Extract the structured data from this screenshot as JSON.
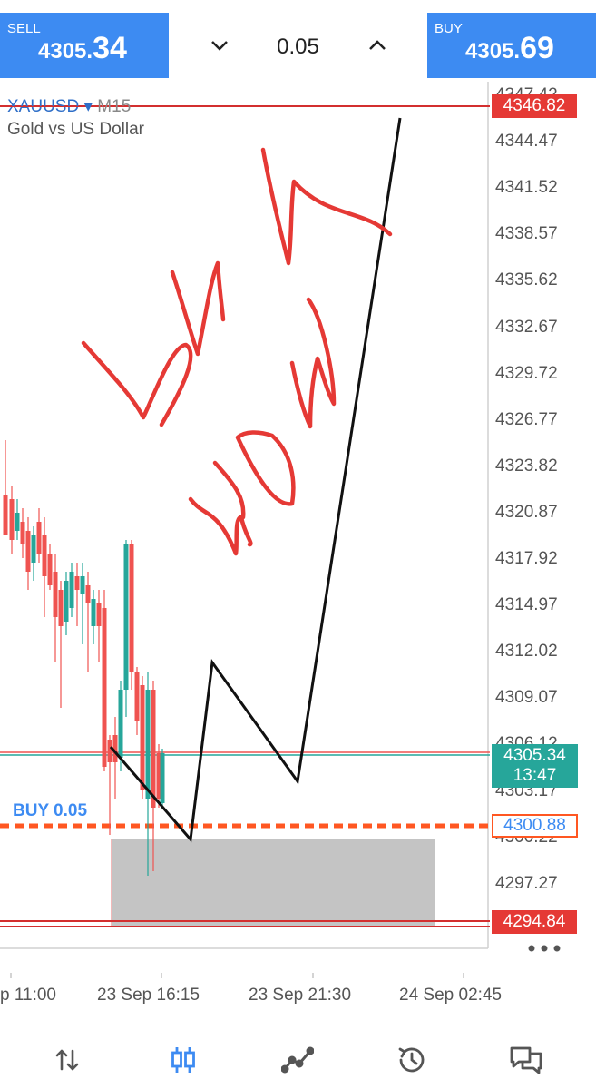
{
  "trade_bar": {
    "sell": {
      "label": "SELL",
      "price_prefix": "4305.",
      "price_suffix": "34"
    },
    "buy": {
      "label": "BUY",
      "price_prefix": "4305.",
      "price_suffix": "69"
    },
    "lot": {
      "value": "0.05",
      "decrease_icon": "chevron-down-icon",
      "increase_icon": "chevron-up-icon"
    }
  },
  "chart": {
    "symbol": "XAUUSD",
    "timeframe": "M15",
    "description": "Gold vs US Dollar",
    "price_ticks": [
      "4347.42",
      "4344.47",
      "4341.52",
      "4338.57",
      "4335.62",
      "4332.67",
      "4329.72",
      "4326.77",
      "4323.82",
      "4320.87",
      "4317.92",
      "4314.97",
      "4312.02",
      "4309.07",
      "4306.12",
      "4303.17",
      "4300.22",
      "4297.27"
    ],
    "tags": {
      "take_profit": "4346.82",
      "bid_price": "4305.34",
      "countdown": "13:47",
      "entry": "4300.88",
      "stop_loss": "4294.84"
    },
    "position_label": "BUY 0.05",
    "time_labels": [
      "p 11:00",
      "23 Sep 16:15",
      "23 Sep 21:30",
      "24 Sep 02:45"
    ],
    "handwriting": "buy now",
    "colors": {
      "bull": "#26a69a",
      "bear": "#ef5350",
      "accent": "#3d8bf2",
      "red_line": "#d32f2f",
      "entry_line": "#ff5722"
    }
  },
  "bottom_nav": [
    "arrows-updown-icon",
    "candlesticks-icon",
    "trend-chart-icon",
    "history-icon",
    "chat-icon"
  ]
}
